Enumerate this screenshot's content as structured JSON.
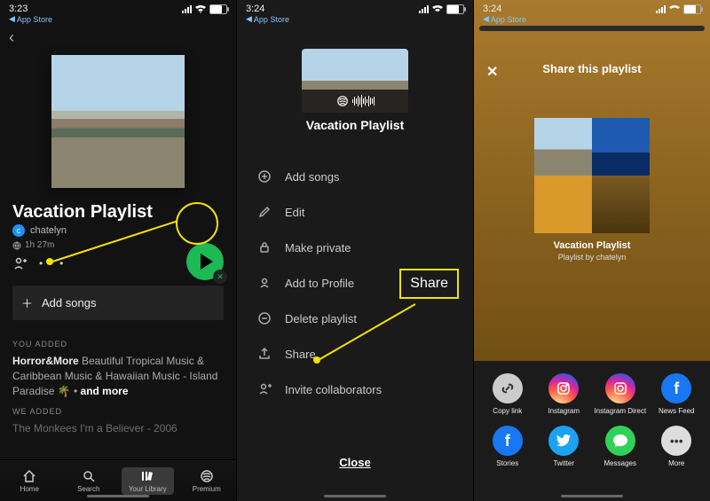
{
  "s1": {
    "time": "3:23",
    "appstore": "App Store",
    "playlist_title": "Vacation Playlist",
    "user": "chatelyn",
    "user_initial": "c",
    "duration": "1h 27m",
    "add_songs": "Add songs",
    "sect_you": "YOU ADDED",
    "track_you_artist": "Horror&More",
    "track_you_rest": " Beautiful Tropical Music & Caribbean Music & Hawaiian Music - Island Paradise 🌴  •  ",
    "and_more": "and more",
    "sect_we": "WE ADDED",
    "track_we": "The Monkees I'm a Believer - 2006",
    "tabs": {
      "home": "Home",
      "search": "Search",
      "library": "Your Library",
      "premium": "Premium"
    }
  },
  "s2": {
    "time": "3:24",
    "appstore": "App Store",
    "ptitle": "Vacation Playlist",
    "items": {
      "add": "Add songs",
      "edit": "Edit",
      "private": "Make private",
      "profile": "Add to Profile",
      "delete": "Delete playlist",
      "share": "Share",
      "invite": "Invite collaborators"
    },
    "close": "Close",
    "callout": "Share"
  },
  "s3": {
    "time": "3:24",
    "appstore": "App Store",
    "header": "Share this playlist",
    "pname": "Vacation Playlist",
    "pby": "Playlist by chatelyn",
    "opts": {
      "copy": "Copy link",
      "ig": "Instagram",
      "igd": "Instagram Direct",
      "fb": "News Feed",
      "stories": "Stories",
      "tw": "Twitter",
      "msg": "Messages",
      "more": "More"
    }
  }
}
